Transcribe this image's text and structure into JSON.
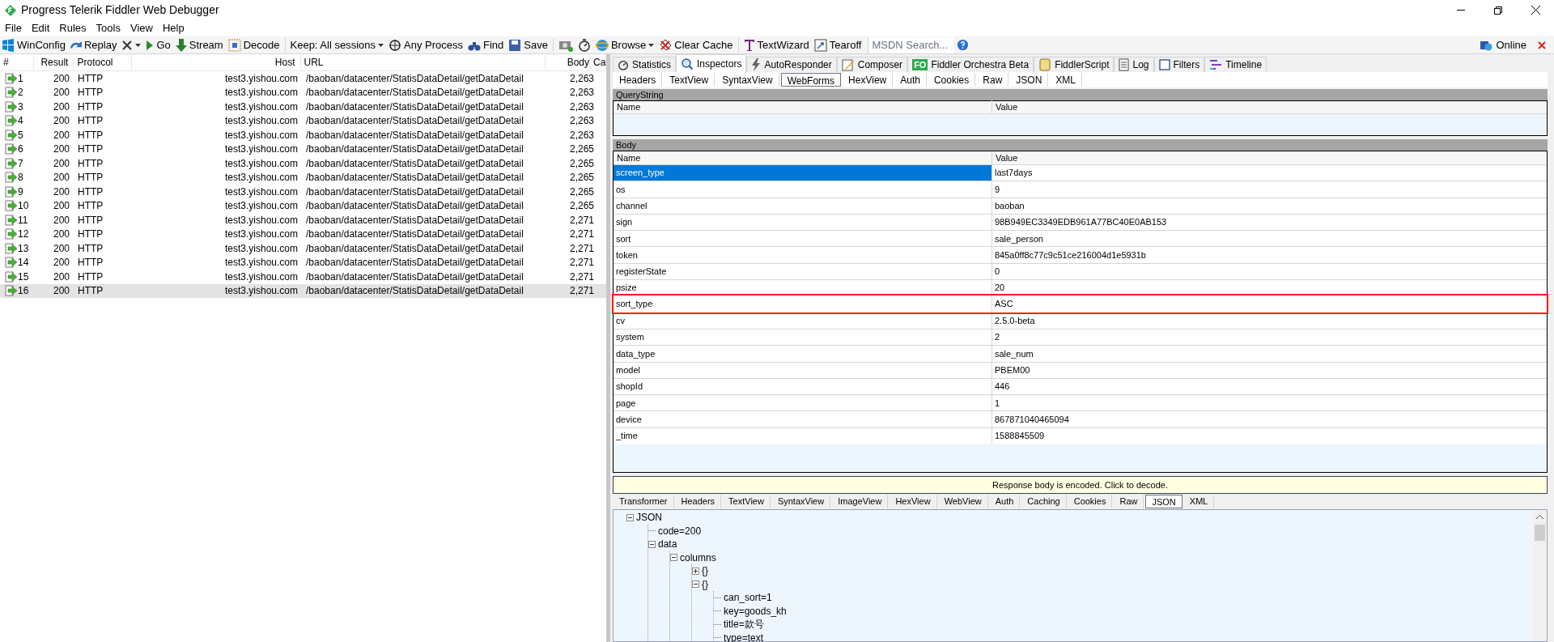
{
  "window": {
    "title": "Progress Telerik Fiddler Web Debugger"
  },
  "menu": [
    "File",
    "Edit",
    "Rules",
    "Tools",
    "View",
    "Help"
  ],
  "toolbar": [
    {
      "kind": "windows",
      "label": "WinConfig"
    },
    {
      "kind": "replay",
      "label": "Replay"
    },
    {
      "kind": "remove",
      "dropdown": true
    },
    {
      "kind": "go",
      "label": "Go"
    },
    {
      "kind": "stream",
      "label": "Stream"
    },
    {
      "kind": "decode",
      "label": "Decode"
    },
    {
      "kind": "keep",
      "label": "Keep: All sessions",
      "dropdown": true
    },
    {
      "kind": "process",
      "label": "Any Process"
    },
    {
      "kind": "find",
      "label": "Find"
    },
    {
      "kind": "save",
      "label": "Save"
    },
    {
      "kind": "camera"
    },
    {
      "kind": "timer"
    },
    {
      "kind": "browse",
      "label": "Browse",
      "dropdown": true
    },
    {
      "kind": "clear",
      "label": "Clear Cache"
    },
    {
      "kind": "wizard",
      "label": "TextWizard"
    },
    {
      "kind": "tearoff",
      "label": "Tearoff"
    }
  ],
  "search": {
    "placeholder": "MSDN Search..."
  },
  "online": {
    "label": "Online"
  },
  "sessions": {
    "columns": [
      "#",
      "Result",
      "Protocol",
      "Host",
      "URL",
      "Body",
      "Ca"
    ],
    "rows": [
      {
        "id": "1",
        "result": "200",
        "protocol": "HTTP",
        "host": "test3.yishou.com",
        "url": "/baoban/datacenter/StatisDataDetail/getDataDetail",
        "body": "2,263",
        "selected": false
      },
      {
        "id": "2",
        "result": "200",
        "protocol": "HTTP",
        "host": "test3.yishou.com",
        "url": "/baoban/datacenter/StatisDataDetail/getDataDetail",
        "body": "2,263",
        "selected": false
      },
      {
        "id": "3",
        "result": "200",
        "protocol": "HTTP",
        "host": "test3.yishou.com",
        "url": "/baoban/datacenter/StatisDataDetail/getDataDetail",
        "body": "2,263",
        "selected": false
      },
      {
        "id": "4",
        "result": "200",
        "protocol": "HTTP",
        "host": "test3.yishou.com",
        "url": "/baoban/datacenter/StatisDataDetail/getDataDetail",
        "body": "2,263",
        "selected": false
      },
      {
        "id": "5",
        "result": "200",
        "protocol": "HTTP",
        "host": "test3.yishou.com",
        "url": "/baoban/datacenter/StatisDataDetail/getDataDetail",
        "body": "2,263",
        "selected": false
      },
      {
        "id": "6",
        "result": "200",
        "protocol": "HTTP",
        "host": "test3.yishou.com",
        "url": "/baoban/datacenter/StatisDataDetail/getDataDetail",
        "body": "2,265",
        "selected": false
      },
      {
        "id": "7",
        "result": "200",
        "protocol": "HTTP",
        "host": "test3.yishou.com",
        "url": "/baoban/datacenter/StatisDataDetail/getDataDetail",
        "body": "2,265",
        "selected": false
      },
      {
        "id": "8",
        "result": "200",
        "protocol": "HTTP",
        "host": "test3.yishou.com",
        "url": "/baoban/datacenter/StatisDataDetail/getDataDetail",
        "body": "2,265",
        "selected": false
      },
      {
        "id": "9",
        "result": "200",
        "protocol": "HTTP",
        "host": "test3.yishou.com",
        "url": "/baoban/datacenter/StatisDataDetail/getDataDetail",
        "body": "2,265",
        "selected": false
      },
      {
        "id": "10",
        "result": "200",
        "protocol": "HTTP",
        "host": "test3.yishou.com",
        "url": "/baoban/datacenter/StatisDataDetail/getDataDetail",
        "body": "2,265",
        "selected": false
      },
      {
        "id": "11",
        "result": "200",
        "protocol": "HTTP",
        "host": "test3.yishou.com",
        "url": "/baoban/datacenter/StatisDataDetail/getDataDetail",
        "body": "2,271",
        "selected": false
      },
      {
        "id": "12",
        "result": "200",
        "protocol": "HTTP",
        "host": "test3.yishou.com",
        "url": "/baoban/datacenter/StatisDataDetail/getDataDetail",
        "body": "2,271",
        "selected": false
      },
      {
        "id": "13",
        "result": "200",
        "protocol": "HTTP",
        "host": "test3.yishou.com",
        "url": "/baoban/datacenter/StatisDataDetail/getDataDetail",
        "body": "2,271",
        "selected": false
      },
      {
        "id": "14",
        "result": "200",
        "protocol": "HTTP",
        "host": "test3.yishou.com",
        "url": "/baoban/datacenter/StatisDataDetail/getDataDetail",
        "body": "2,271",
        "selected": false
      },
      {
        "id": "15",
        "result": "200",
        "protocol": "HTTP",
        "host": "test3.yishou.com",
        "url": "/baoban/datacenter/StatisDataDetail/getDataDetail",
        "body": "2,271",
        "selected": false
      },
      {
        "id": "16",
        "result": "200",
        "protocol": "HTTP",
        "host": "test3.yishou.com",
        "url": "/baoban/datacenter/StatisDataDetail/getDataDetail",
        "body": "2,271",
        "selected": true
      }
    ]
  },
  "main_tabs": [
    {
      "kind": "stats",
      "label": "Statistics",
      "selected": false
    },
    {
      "kind": "inspect",
      "label": "Inspectors",
      "selected": true
    },
    {
      "kind": "bolt",
      "label": "AutoResponder",
      "selected": false
    },
    {
      "kind": "compose",
      "label": "Composer",
      "selected": false
    },
    {
      "kind": "badge",
      "badge": "FO",
      "label": "Fiddler Orchestra Beta",
      "selected": false
    },
    {
      "kind": "script",
      "label": "FiddlerScript",
      "selected": false
    },
    {
      "kind": "log",
      "label": "Log",
      "selected": false
    },
    {
      "kind": "check",
      "label": "Filters",
      "selected": false
    },
    {
      "kind": "timeline",
      "label": "Timeline",
      "selected": false
    }
  ],
  "request_tabs": [
    {
      "label": "Headers",
      "selected": false
    },
    {
      "label": "TextView",
      "selected": false
    },
    {
      "label": "SyntaxView",
      "selected": false
    },
    {
      "label": "WebForms",
      "selected": true
    },
    {
      "label": "HexView",
      "selected": false
    },
    {
      "label": "Auth",
      "selected": false
    },
    {
      "label": "Cookies",
      "selected": false
    },
    {
      "label": "Raw",
      "selected": false
    },
    {
      "label": "JSON",
      "selected": false
    },
    {
      "label": "XML",
      "selected": false
    }
  ],
  "querystring": {
    "title": "QueryString",
    "columns": [
      "Name",
      "Value"
    ]
  },
  "body": {
    "title": "Body",
    "columns": [
      "Name",
      "Value"
    ],
    "rows": [
      {
        "name": "screen_type",
        "value": "last7days",
        "selected": true,
        "highlighted": false
      },
      {
        "name": "os",
        "value": "9",
        "selected": false,
        "highlighted": false
      },
      {
        "name": "channel",
        "value": "baoban",
        "selected": false,
        "highlighted": false
      },
      {
        "name": "sign",
        "value": "98B949EC3349EDB961A77BC40E0AB153",
        "selected": false,
        "highlighted": false
      },
      {
        "name": "sort",
        "value": "sale_person",
        "selected": false,
        "highlighted": false
      },
      {
        "name": "token",
        "value": "845a0ff8c77c9c51ce216004d1e5931b",
        "selected": false,
        "highlighted": false
      },
      {
        "name": "registerState",
        "value": "0",
        "selected": false,
        "highlighted": false
      },
      {
        "name": "psize",
        "value": "20",
        "selected": false,
        "highlighted": false
      },
      {
        "name": "sort_type",
        "value": "ASC",
        "selected": false,
        "highlighted": true
      },
      {
        "name": "cv",
        "value": "2.5.0-beta",
        "selected": false,
        "highlighted": false
      },
      {
        "name": "system",
        "value": "2",
        "selected": false,
        "highlighted": false
      },
      {
        "name": "data_type",
        "value": "sale_num",
        "selected": false,
        "highlighted": false
      },
      {
        "name": "model",
        "value": "PBEM00",
        "selected": false,
        "highlighted": false
      },
      {
        "name": "shopId",
        "value": "446",
        "selected": false,
        "highlighted": false
      },
      {
        "name": "page",
        "value": "1",
        "selected": false,
        "highlighted": false
      },
      {
        "name": "device",
        "value": "867871040465094",
        "selected": false,
        "highlighted": false
      },
      {
        "name": "_time",
        "value": "1588845509",
        "selected": false,
        "highlighted": false
      }
    ]
  },
  "notice": "Response body is encoded. Click to decode.",
  "response_tabs": [
    {
      "label": "Transformer",
      "selected": false
    },
    {
      "label": "Headers",
      "selected": false
    },
    {
      "label": "TextView",
      "selected": false
    },
    {
      "label": "SyntaxView",
      "selected": false
    },
    {
      "label": "ImageView",
      "selected": false
    },
    {
      "label": "HexView",
      "selected": false
    },
    {
      "label": "WebView",
      "selected": false
    },
    {
      "label": "Auth",
      "selected": false
    },
    {
      "label": "Caching",
      "selected": false
    },
    {
      "label": "Cookies",
      "selected": false
    },
    {
      "label": "Raw",
      "selected": false
    },
    {
      "label": "JSON",
      "selected": true
    },
    {
      "label": "XML",
      "selected": false
    }
  ],
  "tree": [
    {
      "label": "JSON",
      "expanded": true,
      "children": [
        {
          "label": "code=200"
        },
        {
          "label": "data",
          "expanded": true,
          "children": [
            {
              "label": "columns",
              "expanded": true,
              "children": [
                {
                  "label": "{}",
                  "expanded": false
                },
                {
                  "label": "{}",
                  "expanded": true,
                  "children": [
                    {
                      "label": "can_sort=1"
                    },
                    {
                      "label": "key=goods_kh"
                    },
                    {
                      "label": "title=款号"
                    },
                    {
                      "label": "type=text"
                    }
                  ]
                }
              ]
            }
          ]
        }
      ]
    }
  ]
}
